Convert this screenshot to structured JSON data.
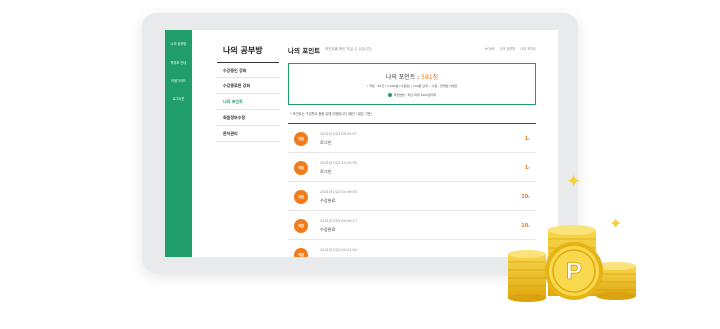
{
  "nav": {
    "items": [
      "나의 공부방",
      "학부모 안내",
      "이용가이드",
      "로그아웃"
    ]
  },
  "side": {
    "title": "나의 공부방",
    "items": [
      "수강중인 강좌",
      "수강종료된 강좌",
      "나의 포인트",
      "회원정보수정",
      "문자관리"
    ]
  },
  "main": {
    "title": "나의 포인트",
    "subtitle": "포인트를 확인 하실 수 있습니다.",
    "breadcrumb": [
      "HOME",
      "나의 공부방",
      "나의 포인트"
    ]
  },
  "point_box": {
    "title_prefix": "나의 포인트 : ",
    "value": "581점",
    "detail": "• 적립 : 87건 | 2,580원 (사용일) | 100원 단위 • 사용 : 현재월 이벤트",
    "note": "적립방법 : 학년 최대 1000원까지"
  },
  "notice": "• 포인트는 구입학교 중점 유예 이용됩니다 (폐년 1일은 기준)",
  "rows": [
    {
      "badge": "적립",
      "date": "2021/07/23 09:52:07",
      "desc": "로그인",
      "points": "1",
      "unit": "P"
    },
    {
      "badge": "적립",
      "date": "2021/07/22 13:25:35",
      "desc": "로그인",
      "points": "1",
      "unit": "P"
    },
    {
      "badge": "적립",
      "date": "2021/07/22 04:49:55",
      "desc": "수강완료",
      "points": "10",
      "unit": "P"
    },
    {
      "badge": "적립",
      "date": "2021/07/22 04:49:17",
      "desc": "수강완료",
      "points": "10",
      "unit": "P"
    },
    {
      "badge": "적립",
      "date": "2021/07/22 04:47:04",
      "desc": "",
      "points": "",
      "unit": ""
    }
  ],
  "coin_label": "P",
  "colors": {
    "accent": "#1f9e6a",
    "point": "#f07c1b",
    "coin": "#f5c518"
  }
}
